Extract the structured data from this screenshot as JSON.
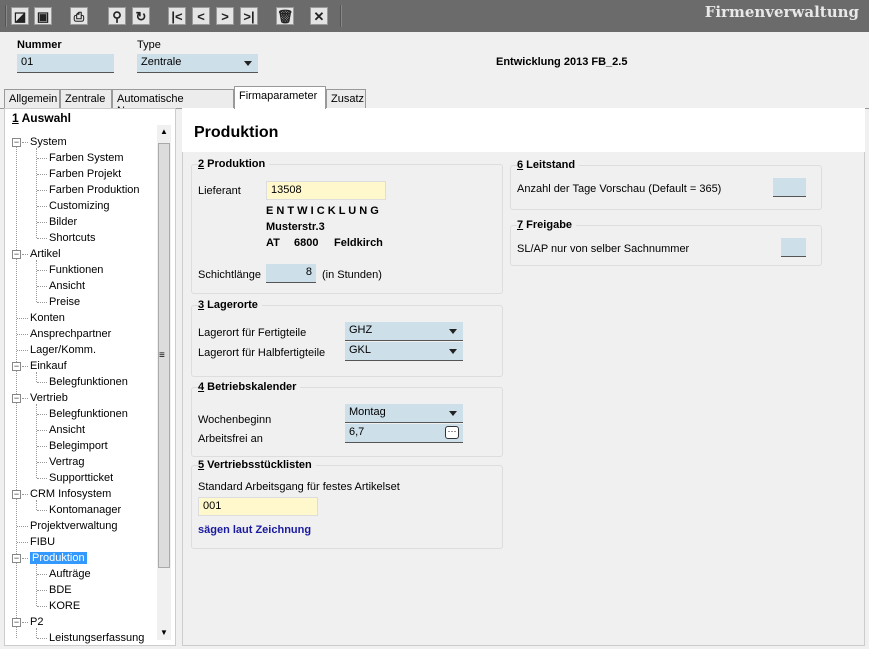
{
  "app_title": "Firmenverwaltung",
  "toolbar": {
    "icons": [
      "edit-icon",
      "save-icon",
      "print-icon",
      "search-icon",
      "refresh-icon",
      "first-record-icon",
      "previous-record-icon",
      "next-record-icon",
      "last-record-icon",
      "delete-icon",
      "close-icon"
    ],
    "glyphs": [
      "◪",
      "▣",
      "⎙",
      "⚲",
      "↻",
      "|<",
      "<",
      ">",
      ">|",
      "🗑",
      "✕"
    ]
  },
  "header": {
    "nummer_label": "Nummer",
    "nummer_value": "01",
    "type_label": "Type",
    "type_value": "Zentrale",
    "info": "Entwicklung 2013 FB_2.5"
  },
  "tabs": [
    {
      "label": "Allgemein"
    },
    {
      "label": "Zentrale"
    },
    {
      "label": "Automatische Nummern"
    },
    {
      "label": "Firmaparameter",
      "active": true
    },
    {
      "label": "Zusatz"
    }
  ],
  "tree": {
    "title_num": "1",
    "title": " Auswahl",
    "items": [
      {
        "label": "System",
        "level": 0,
        "expanded": true
      },
      {
        "label": "Farben System",
        "level": 1
      },
      {
        "label": "Farben Projekt",
        "level": 1
      },
      {
        "label": "Farben Produktion",
        "level": 1
      },
      {
        "label": "Customizing",
        "level": 1
      },
      {
        "label": "Bilder",
        "level": 1
      },
      {
        "label": "Shortcuts",
        "level": 1
      },
      {
        "label": "Artikel",
        "level": 0,
        "expanded": true
      },
      {
        "label": "Funktionen",
        "level": 1
      },
      {
        "label": "Ansicht",
        "level": 1
      },
      {
        "label": "Preise",
        "level": 1
      },
      {
        "label": "Konten",
        "level": 0
      },
      {
        "label": "Ansprechpartner",
        "level": 0
      },
      {
        "label": "Lager/Komm.",
        "level": 0
      },
      {
        "label": "Einkauf",
        "level": 0,
        "expanded": true
      },
      {
        "label": "Belegfunktionen",
        "level": 1
      },
      {
        "label": "Vertrieb",
        "level": 0,
        "expanded": true
      },
      {
        "label": "Belegfunktionen",
        "level": 1
      },
      {
        "label": "Ansicht",
        "level": 1
      },
      {
        "label": "Belegimport",
        "level": 1
      },
      {
        "label": "Vertrag",
        "level": 1
      },
      {
        "label": "Supportticket",
        "level": 1
      },
      {
        "label": "CRM Infosystem",
        "level": 0,
        "expanded": true
      },
      {
        "label": "Kontomanager",
        "level": 1
      },
      {
        "label": "Projektverwaltung",
        "level": 0
      },
      {
        "label": "FIBU",
        "level": 0
      },
      {
        "label": "Produktion",
        "level": 0,
        "expanded": true,
        "selected": true
      },
      {
        "label": "Aufträge",
        "level": 1
      },
      {
        "label": "BDE",
        "level": 1
      },
      {
        "label": "KORE",
        "level": 1
      },
      {
        "label": "P2",
        "level": 0,
        "expanded": true
      },
      {
        "label": "Leistungserfassung",
        "level": 1
      }
    ]
  },
  "main": {
    "title": "Produktion",
    "produktion": {
      "num": "2",
      "title": " Produktion",
      "lieferant_label": "Lieferant",
      "lieferant_value": "13508",
      "name": "E N T W I C K L U N G",
      "street": "Musterstr.3",
      "country": "AT",
      "zip": "6800",
      "city": "Feldkirch",
      "schicht_label": "Schichtlänge",
      "schicht_value": "8",
      "schicht_unit": "(in Stunden)"
    },
    "lagerorte": {
      "num": "3",
      "title": " Lagerorte",
      "fertig_label": "Lagerort für Fertigteile",
      "fertig_value": "GHZ",
      "halb_label": "Lagerort für Halbfertigteile",
      "halb_value": "GKL"
    },
    "kalender": {
      "num": "4",
      "title": " Betriebskalender",
      "woche_label": "Wochenbeginn",
      "woche_value": "Montag",
      "frei_label": "Arbeitsfrei an",
      "frei_value": "6,7"
    },
    "vertrieb": {
      "num": "5",
      "title": " Vertriebsstücklisten",
      "label": "Standard Arbeitsgang für festes Artikelset",
      "value": "001",
      "link": "sägen laut Zeichnung"
    },
    "leitstand": {
      "num": "6",
      "title": " Leitstand",
      "label": "Anzahl der Tage Vorschau (Default = 365)",
      "value": ""
    },
    "freigabe": {
      "num": "7",
      "title": " Freigabe",
      "label": "SL/AP nur von selber Sachnummer",
      "value": ""
    }
  }
}
